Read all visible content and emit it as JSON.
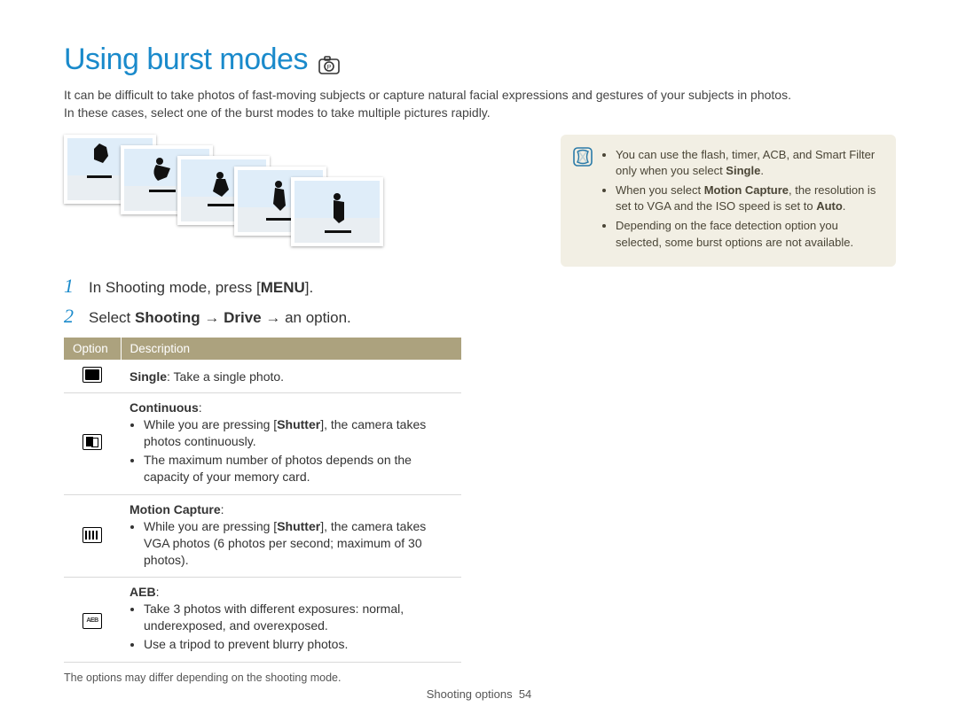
{
  "header": {
    "title": "Using burst modes",
    "mode_icon": "program-mode-icon"
  },
  "intro": {
    "line1": "It can be difficult to take photos of fast-moving subjects or capture natural facial expressions and gestures of your subjects in photos.",
    "line2": "In these cases, select one of the burst modes to take multiple pictures rapidly."
  },
  "steps": [
    {
      "num": "1",
      "pre": "In Shooting mode, press [",
      "bold": "MENU",
      "post": "]."
    },
    {
      "num": "2",
      "pre": "Select ",
      "bold1": "Shooting",
      "arrow1": " → ",
      "bold2": "Drive",
      "arrow2": " → ",
      "post": "an option."
    }
  ],
  "table": {
    "headers": {
      "option": "Option",
      "description": "Description"
    },
    "rows": [
      {
        "icon": "single",
        "name": "Single",
        "desc_plain": ": Take a single photo.",
        "bullets": []
      },
      {
        "icon": "continuous",
        "name": "Continuous",
        "desc_plain": ":",
        "bullets": [
          {
            "pre": "While you are pressing [",
            "bold": "Shutter",
            "post": "], the camera takes photos continuously."
          },
          {
            "pre": "The maximum number of photos depends on the capacity of your memory card.",
            "bold": "",
            "post": ""
          }
        ]
      },
      {
        "icon": "motion",
        "name": "Motion Capture",
        "desc_plain": ":",
        "bullets": [
          {
            "pre": "While you are pressing [",
            "bold": "Shutter",
            "post": "], the camera takes VGA photos (6 photos per second; maximum of 30 photos)."
          }
        ]
      },
      {
        "icon": "aeb",
        "name": "AEB",
        "desc_plain": ":",
        "bullets": [
          {
            "pre": "Take 3 photos with different exposures: normal, underexposed, and overexposed.",
            "bold": "",
            "post": ""
          },
          {
            "pre": "Use a tripod to prevent blurry photos.",
            "bold": "",
            "post": ""
          }
        ]
      }
    ],
    "footnote": "The options may differ depending on the shooting mode."
  },
  "note": {
    "items": [
      {
        "pre": "You can use the flash, timer, ACB, and Smart Filter only when you select ",
        "bold": "Single",
        "post": "."
      },
      {
        "pre": "When you select ",
        "bold": "Motion Capture",
        "post": ", the resolution is set to VGA and the ISO speed is set to ",
        "bold2": "Auto",
        "post2": "."
      },
      {
        "pre": "Depending on the face detection option you selected, some burst options are not available.",
        "bold": "",
        "post": ""
      }
    ]
  },
  "footer": {
    "section": "Shooting options",
    "page": "54"
  }
}
